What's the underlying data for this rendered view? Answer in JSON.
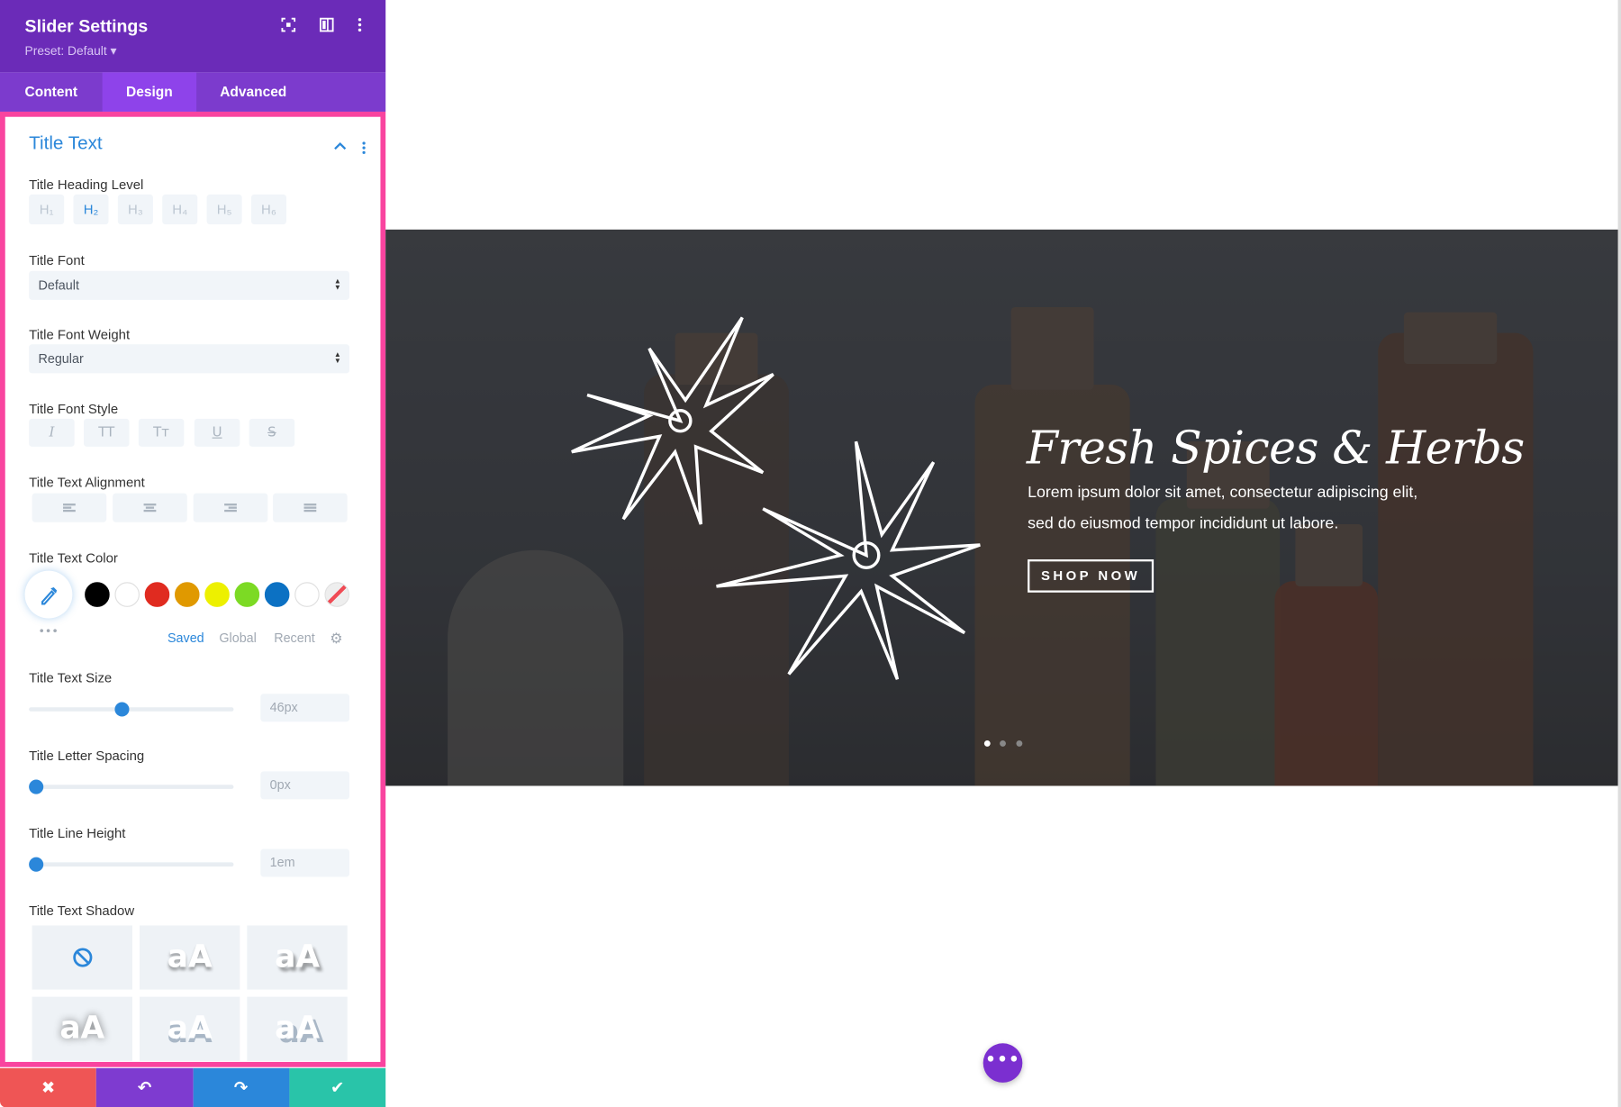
{
  "panel": {
    "title": "Slider Settings",
    "preset": "Preset: Default ▾",
    "header_icons": [
      "fullscreen-icon",
      "columns-icon",
      "more-vertical-icon"
    ],
    "tabs": [
      {
        "label": "Content",
        "active": false
      },
      {
        "label": "Design",
        "active": true
      },
      {
        "label": "Advanced",
        "active": false
      }
    ],
    "section": {
      "title": "Title Text",
      "heading_level": {
        "label": "Title Heading Level",
        "options": [
          "H₁",
          "H₂",
          "H₃",
          "H₄",
          "H₅",
          "H₆"
        ],
        "selected": "H₂"
      },
      "font": {
        "label": "Title Font",
        "value": "Default"
      },
      "font_weight": {
        "label": "Title Font Weight",
        "value": "Regular"
      },
      "font_style": {
        "label": "Title Font Style",
        "options": [
          "I",
          "TT",
          "Tт",
          "U",
          "S"
        ]
      },
      "alignment": {
        "label": "Title Text Alignment",
        "options": [
          "left",
          "center",
          "right",
          "justify"
        ]
      },
      "color": {
        "label": "Title Text Color",
        "swatches": [
          "#000000",
          "#ffffff",
          "#e02b20",
          "#e09900",
          "#edf000",
          "#7cda24",
          "#0c71c3",
          "#ffffff",
          "none"
        ],
        "more": "•••",
        "tabs": [
          "Saved",
          "Global",
          "Recent"
        ],
        "active_tab": "Saved"
      },
      "text_size": {
        "label": "Title Text Size",
        "value": "46px"
      },
      "letter_spacing": {
        "label": "Title Letter Spacing",
        "value": "0px"
      },
      "line_height": {
        "label": "Title Line Height",
        "value": "1em"
      },
      "text_shadow": {
        "label": "Title Text Shadow",
        "preview": "aA"
      }
    },
    "actions": {
      "cancel": "✖",
      "undo": "↶",
      "redo": "↷",
      "save": "✔"
    },
    "colors": {
      "header": "#6b2bb8",
      "accent": "#2b87da",
      "frame": "#f9449f",
      "cancel": "#ef5555",
      "undo": "#7e3bd0",
      "redo": "#2b87da",
      "save": "#29c4a9"
    }
  },
  "hero": {
    "title": "Fresh Spices & Herbs",
    "text_line1": "Lorem ipsum dolor sit amet, consectetur adipiscing elit,",
    "text_line2": "sed do eiusmod tempor incididunt ut labore.",
    "button": "SHOP NOW",
    "slides": 3,
    "active_slide": 1
  },
  "fab": {
    "label": "•••"
  }
}
